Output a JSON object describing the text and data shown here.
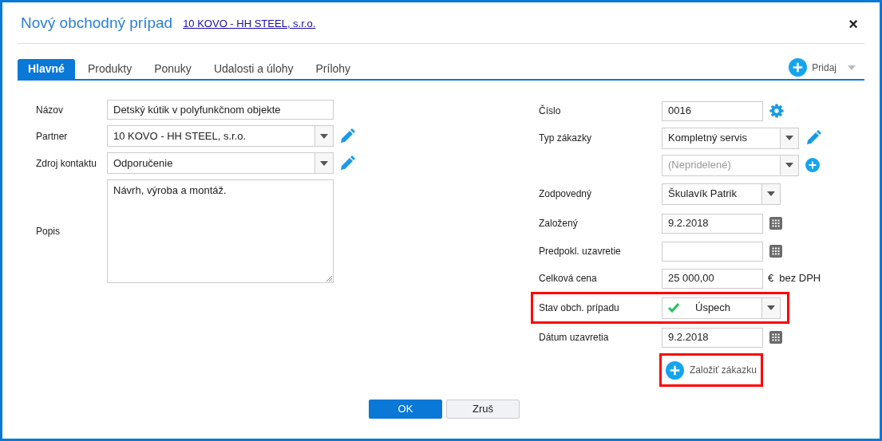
{
  "dialog": {
    "title": "Nový obchodný prípad",
    "partner_link": "10 KOVO - HH STEEL, s.r.o.",
    "close": "×"
  },
  "tabs": [
    {
      "label": "Hlavné",
      "selected": true
    },
    {
      "label": "Produkty",
      "selected": false
    },
    {
      "label": "Ponuky",
      "selected": false
    },
    {
      "label": "Udalosti a úlohy",
      "selected": false
    },
    {
      "label": "Prílohy",
      "selected": false
    }
  ],
  "add_menu": {
    "label": "Pridaj"
  },
  "left_fields": [
    {
      "kind": "text",
      "label": "Názov",
      "value": "Detský kútik v polyfunkčnom objekte"
    },
    {
      "kind": "select",
      "label": "Partner",
      "value": "10 KOVO - HH STEEL, s.r.o.",
      "action": {
        "kind": "edit"
      }
    },
    {
      "kind": "select",
      "label": "Zdroj kontaktu",
      "value": "Odporučenie",
      "action": {
        "kind": "edit"
      }
    },
    {
      "kind": "textarea",
      "label": "Popis",
      "value": "Návrh, výroba a montáž."
    }
  ],
  "right_fields": [
    {
      "kind": "text",
      "label": "Číslo",
      "value": "0016",
      "action": {
        "kind": "settings"
      },
      "highlighted": false
    },
    {
      "kind": "select",
      "label": "Typ zákazky",
      "value": "Kompletný servis",
      "action": {
        "kind": "edit"
      },
      "highlighted": false
    },
    {
      "kind": "select",
      "placeholder": "(Nepridelené)",
      "action": {
        "kind": "add"
      },
      "highlighted": false
    },
    {
      "kind": "select-short",
      "label": "Zodpovedný",
      "value": "Škulavík Patrik",
      "highlighted": false
    },
    {
      "kind": "date",
      "label": "Založený",
      "value": "9.2.2018",
      "action": {
        "kind": "calendar"
      },
      "highlighted": false
    },
    {
      "kind": "date",
      "label": "Predpokl. uzavretie",
      "action": {
        "kind": "calendar"
      },
      "highlighted": false
    },
    {
      "kind": "money",
      "label": "Celková cena",
      "value": "25 000,00",
      "currency": "€",
      "suffix": "bez DPH",
      "highlighted": false
    },
    {
      "kind": "status",
      "label": "Stav obch. prípadu",
      "value": "Úspech",
      "color": "#22c55e",
      "highlighted": true
    },
    {
      "kind": "date",
      "label": "Dátum uzavretia",
      "value": "9.2.2018",
      "action": {
        "kind": "calendar"
      },
      "highlighted": false
    }
  ],
  "create_order_button": {
    "label": "Založiť zákazku",
    "highlighted": true
  },
  "buttons": {
    "ok": "OK",
    "cancel": "Zruš"
  }
}
